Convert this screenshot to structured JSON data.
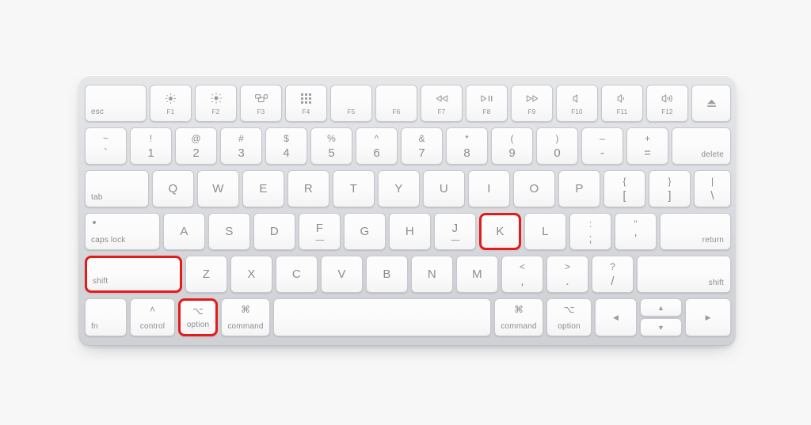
{
  "scene": {
    "background_color": "#f7f7f7",
    "device": "apple-magic-keyboard",
    "highlight_color": "#e41b1b",
    "key_text_color": "#8c8d90",
    "chassis_color": "#dcdee1"
  },
  "highlighted_keys": [
    "shift-left",
    "option-left",
    "k"
  ],
  "rows": {
    "function": [
      {
        "id": "esc",
        "label": "esc",
        "icon": "",
        "style": "bottom-left"
      },
      {
        "id": "f1",
        "label": "F1",
        "icon": "brightness-down-icon",
        "style": "fn"
      },
      {
        "id": "f2",
        "label": "F2",
        "icon": "brightness-up-icon",
        "style": "fn"
      },
      {
        "id": "f3",
        "label": "F3",
        "icon": "mission-control-icon",
        "style": "fn"
      },
      {
        "id": "f4",
        "label": "F4",
        "icon": "launchpad-icon",
        "style": "fn"
      },
      {
        "id": "f5",
        "label": "F5",
        "icon": "",
        "style": "fn"
      },
      {
        "id": "f6",
        "label": "F6",
        "icon": "",
        "style": "fn"
      },
      {
        "id": "f7",
        "label": "F7",
        "icon": "rewind-icon",
        "style": "fn"
      },
      {
        "id": "f8",
        "label": "F8",
        "icon": "play-pause-icon",
        "style": "fn"
      },
      {
        "id": "f9",
        "label": "F9",
        "icon": "fast-forward-icon",
        "style": "fn"
      },
      {
        "id": "f10",
        "label": "F10",
        "icon": "mute-icon",
        "style": "fn"
      },
      {
        "id": "f11",
        "label": "F11",
        "icon": "volume-down-icon",
        "style": "fn"
      },
      {
        "id": "f12",
        "label": "F12",
        "icon": "volume-up-icon",
        "style": "fn"
      },
      {
        "id": "eject",
        "label": "",
        "icon": "eject-icon",
        "style": "icon-only"
      }
    ],
    "number": [
      {
        "id": "grave",
        "upper": "~",
        "lower": "`"
      },
      {
        "id": "1",
        "upper": "!",
        "lower": "1"
      },
      {
        "id": "2",
        "upper": "@",
        "lower": "2"
      },
      {
        "id": "3",
        "upper": "#",
        "lower": "3"
      },
      {
        "id": "4",
        "upper": "$",
        "lower": "4"
      },
      {
        "id": "5",
        "upper": "%",
        "lower": "5"
      },
      {
        "id": "6",
        "upper": "^",
        "lower": "6"
      },
      {
        "id": "7",
        "upper": "&",
        "lower": "7"
      },
      {
        "id": "8",
        "upper": "*",
        "lower": "8"
      },
      {
        "id": "9",
        "upper": "(",
        "lower": "9"
      },
      {
        "id": "0",
        "upper": ")",
        "lower": "0"
      },
      {
        "id": "minus",
        "upper": "–",
        "lower": "-"
      },
      {
        "id": "equal",
        "upper": "+",
        "lower": "="
      },
      {
        "id": "delete",
        "label": "delete"
      }
    ],
    "qwerty": [
      {
        "id": "tab",
        "label": "tab"
      },
      {
        "id": "q",
        "label": "Q"
      },
      {
        "id": "w",
        "label": "W"
      },
      {
        "id": "e",
        "label": "E"
      },
      {
        "id": "r",
        "label": "R"
      },
      {
        "id": "t",
        "label": "T"
      },
      {
        "id": "y",
        "label": "Y"
      },
      {
        "id": "u",
        "label": "U"
      },
      {
        "id": "i",
        "label": "I"
      },
      {
        "id": "o",
        "label": "O"
      },
      {
        "id": "p",
        "label": "P"
      },
      {
        "id": "bracket-left",
        "upper": "{",
        "lower": "["
      },
      {
        "id": "bracket-right",
        "upper": "}",
        "lower": "]"
      },
      {
        "id": "backslash",
        "upper": "|",
        "lower": "\\"
      }
    ],
    "home": [
      {
        "id": "caps-lock",
        "label": "caps lock"
      },
      {
        "id": "a",
        "label": "A"
      },
      {
        "id": "s",
        "label": "S"
      },
      {
        "id": "d",
        "label": "D"
      },
      {
        "id": "f",
        "label": "F",
        "homing": true
      },
      {
        "id": "g",
        "label": "G"
      },
      {
        "id": "h",
        "label": "H"
      },
      {
        "id": "j",
        "label": "J",
        "homing": true
      },
      {
        "id": "k",
        "label": "K",
        "highlight": true
      },
      {
        "id": "l",
        "label": "L"
      },
      {
        "id": "semicolon",
        "upper": ":",
        "lower": ";"
      },
      {
        "id": "quote",
        "upper": "\"",
        "lower": "'"
      },
      {
        "id": "return",
        "label": "return"
      }
    ],
    "zxcv": [
      {
        "id": "shift-left",
        "label": "shift",
        "highlight": true
      },
      {
        "id": "z",
        "label": "Z"
      },
      {
        "id": "x",
        "label": "X"
      },
      {
        "id": "c",
        "label": "C"
      },
      {
        "id": "v",
        "label": "V"
      },
      {
        "id": "b",
        "label": "B"
      },
      {
        "id": "n",
        "label": "N"
      },
      {
        "id": "m",
        "label": "M"
      },
      {
        "id": "comma",
        "upper": "<",
        "lower": ","
      },
      {
        "id": "period",
        "upper": ">",
        "lower": "."
      },
      {
        "id": "slash",
        "upper": "?",
        "lower": "/"
      },
      {
        "id": "shift-right",
        "label": "shift"
      }
    ],
    "bottom": [
      {
        "id": "fn",
        "label": "fn",
        "symbol": ""
      },
      {
        "id": "control",
        "label": "control",
        "symbol": "˄"
      },
      {
        "id": "option-left",
        "label": "option",
        "symbol": "⌥",
        "highlight": true
      },
      {
        "id": "command-left",
        "label": "command",
        "symbol": "⌘"
      },
      {
        "id": "space",
        "label": "",
        "symbol": ""
      },
      {
        "id": "command-right",
        "label": "command",
        "symbol": "⌘"
      },
      {
        "id": "option-right",
        "label": "option",
        "symbol": "⌥"
      },
      {
        "id": "arrow-left",
        "label": "",
        "symbol": "◀"
      },
      {
        "id": "arrow-up",
        "label": "",
        "symbol": "▲"
      },
      {
        "id": "arrow-down",
        "label": "",
        "symbol": "▼"
      },
      {
        "id": "arrow-right",
        "label": "",
        "symbol": "▶"
      }
    ]
  }
}
